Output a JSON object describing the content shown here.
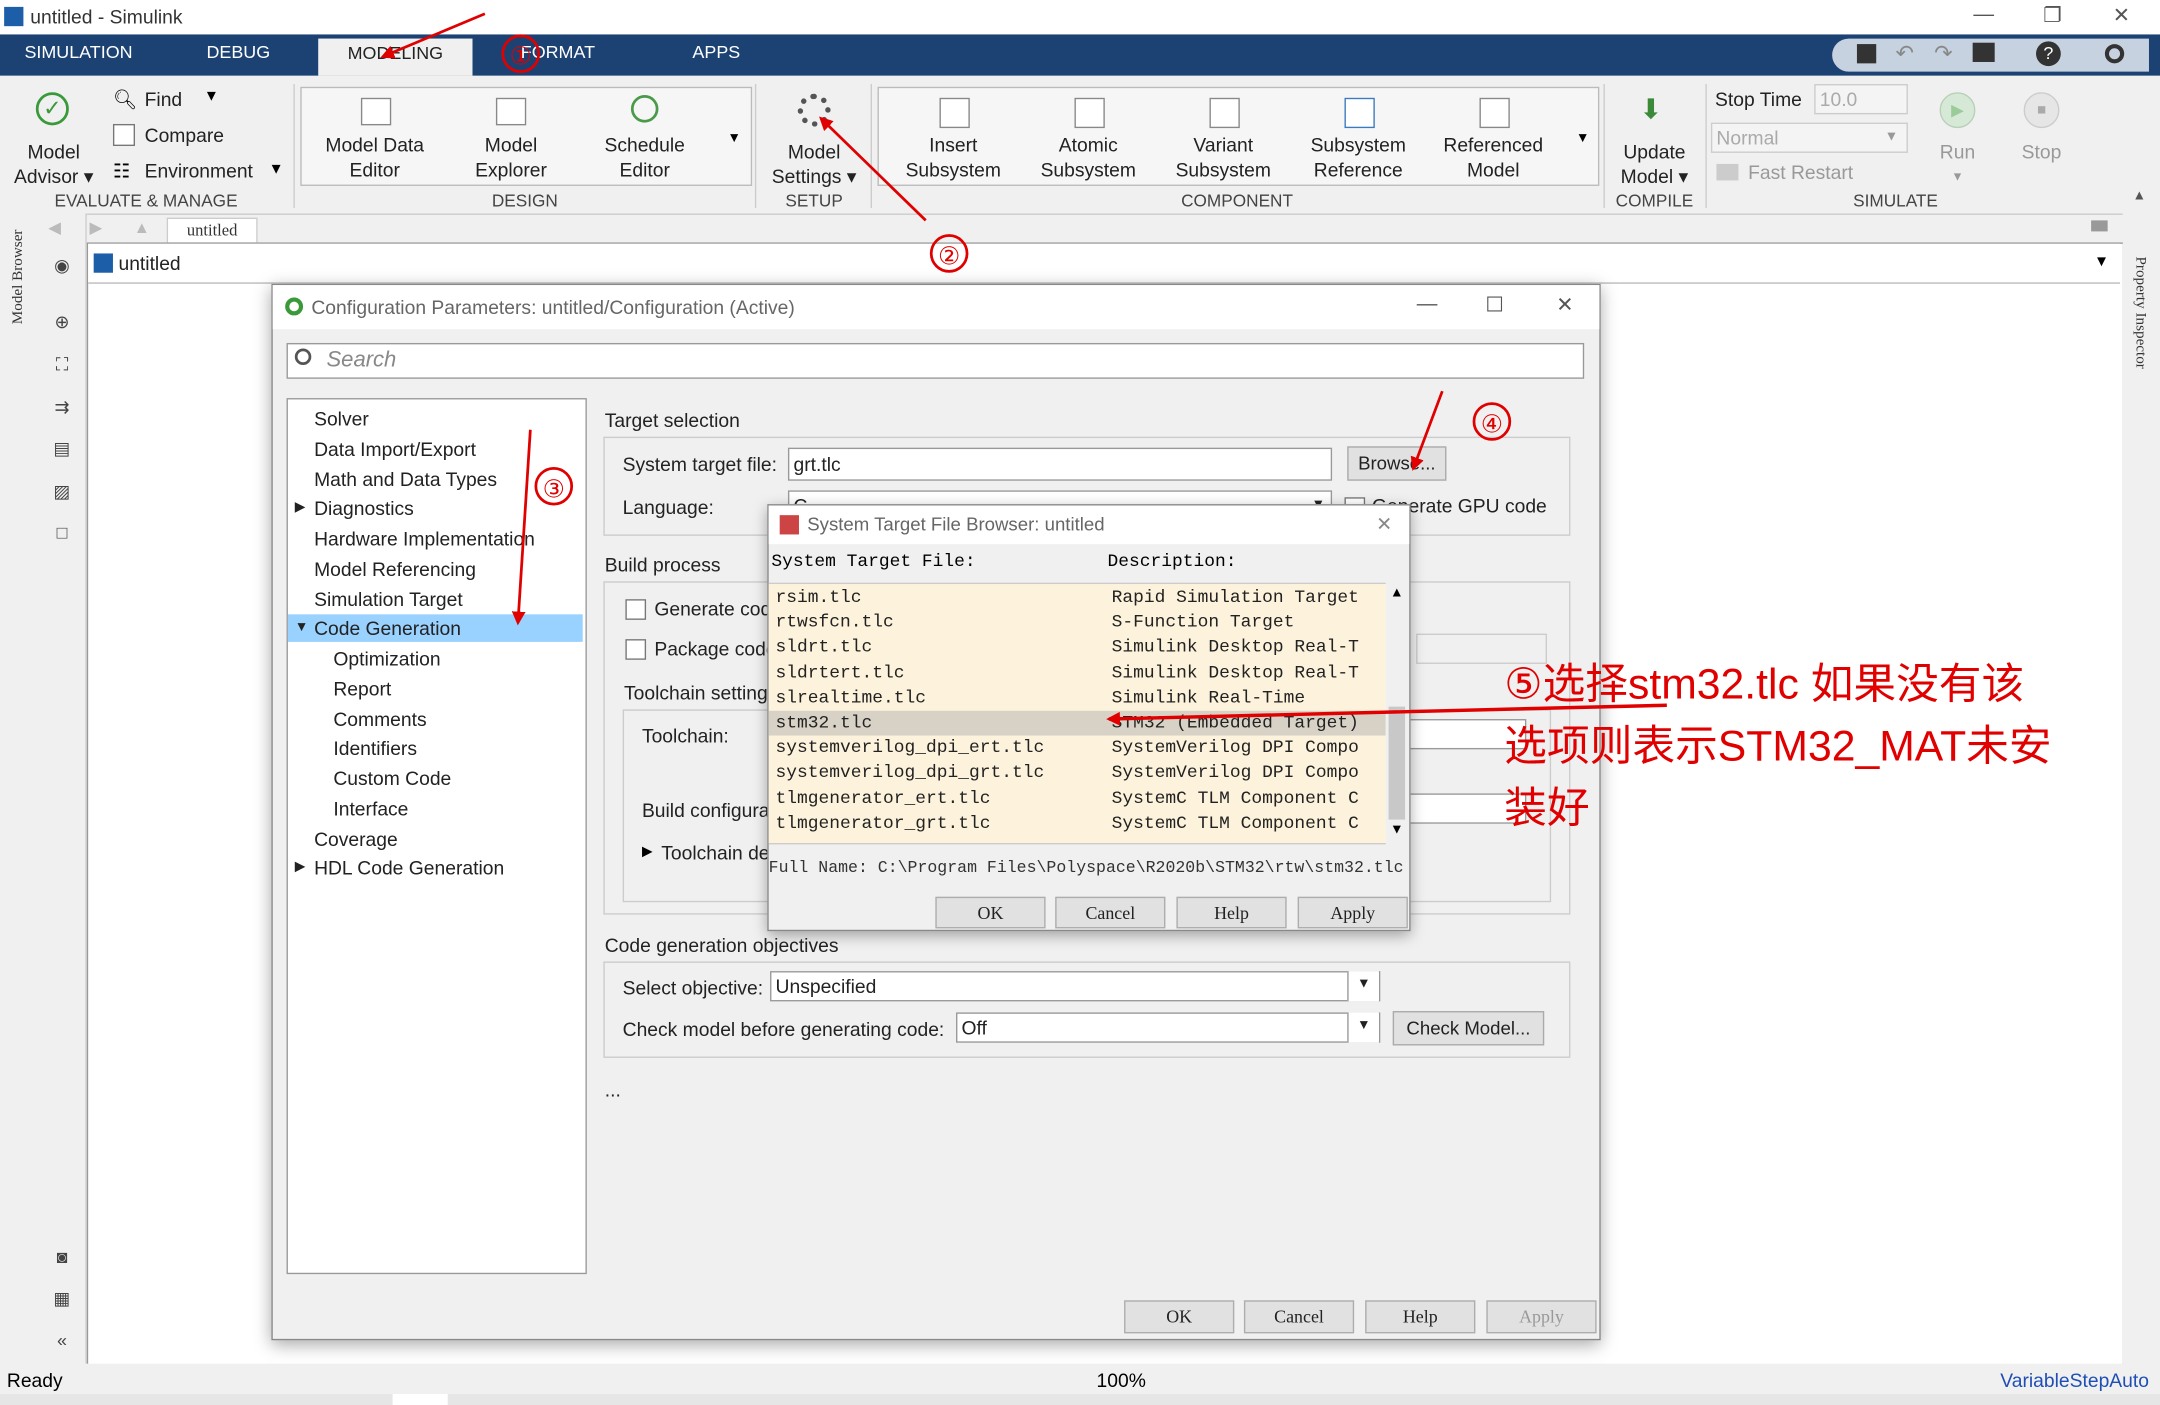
{
  "window": {
    "title": "untitled - Simulink"
  },
  "tabs": [
    "SIMULATION",
    "DEBUG",
    "MODELING",
    "FORMAT",
    "APPS"
  ],
  "ribbon": {
    "evaluate": {
      "model_advisor": [
        "Model",
        "Advisor"
      ],
      "find": "Find",
      "compare": "Compare",
      "environment": "Environment",
      "group": "EVALUATE & MANAGE"
    },
    "design": {
      "items": [
        [
          "Model Data",
          "Editor"
        ],
        [
          "Model",
          "Explorer"
        ],
        [
          "Schedule",
          "Editor"
        ]
      ],
      "group": "DESIGN"
    },
    "setup": {
      "item": [
        "Model",
        "Settings"
      ],
      "group": "SETUP"
    },
    "component": {
      "items": [
        [
          "Insert",
          "Subsystem"
        ],
        [
          "Atomic",
          "Subsystem"
        ],
        [
          "Variant",
          "Subsystem"
        ],
        [
          "Subsystem",
          "Reference"
        ],
        [
          "Referenced",
          "Model"
        ]
      ],
      "group": "COMPONENT"
    },
    "compile": {
      "item": [
        "Update",
        "Model"
      ],
      "group": "COMPILE"
    },
    "simulate": {
      "stop_time_label": "Stop Time",
      "stop_time": "10.0",
      "mode": "Normal",
      "fast_restart": "Fast Restart",
      "run": "Run",
      "stop": "Stop",
      "group": "SIMULATE"
    }
  },
  "side_tabs": {
    "left": "Model Browser",
    "right": "Property Inspector"
  },
  "editor": {
    "breadcrumb_tab": "untitled",
    "path": "untitled"
  },
  "status": {
    "left": "Ready",
    "zoom": "100%",
    "solver": "VariableStepAuto"
  },
  "config": {
    "title": "Configuration Parameters: untitled/Configuration (Active)",
    "search_placeholder": "Search",
    "tree": [
      {
        "label": "Solver",
        "level": 0
      },
      {
        "label": "Data Import/Export",
        "level": 0
      },
      {
        "label": "Math and Data Types",
        "level": 0
      },
      {
        "label": "Diagnostics",
        "level": 0,
        "arrow": "▶"
      },
      {
        "label": "Hardware Implementation",
        "level": 0
      },
      {
        "label": "Model Referencing",
        "level": 0
      },
      {
        "label": "Simulation Target",
        "level": 0
      },
      {
        "label": "Code Generation",
        "level": 0,
        "arrow": "▼",
        "selected": true
      },
      {
        "label": "Optimization",
        "level": 1
      },
      {
        "label": "Report",
        "level": 1
      },
      {
        "label": "Comments",
        "level": 1
      },
      {
        "label": "Identifiers",
        "level": 1
      },
      {
        "label": "Custom Code",
        "level": 1
      },
      {
        "label": "Interface",
        "level": 1
      },
      {
        "label": "Coverage",
        "level": 0
      },
      {
        "label": "HDL Code Generation",
        "level": 0,
        "arrow": "▶"
      }
    ],
    "target_selection": "Target selection",
    "system_target_label": "System target file:",
    "system_target_value": "grt.tlc",
    "browse": "Browse...",
    "language_label": "Language:",
    "language_value": "C",
    "gpu": "Generate GPU code",
    "build_process": "Build process",
    "generate_code": "Generate code only",
    "package_code": "Package code and artifacts",
    "toolchain_settings": "Toolchain settings",
    "toolchain_label": "Toolchain:",
    "build_config_label": "Build configuration",
    "toolchain_details": "Toolchain details",
    "objectives": "Code generation objectives",
    "select_objective_label": "Select objective:",
    "select_objective_value": "Unspecified",
    "check_model_label": "Check model before generating code:",
    "check_model_value": "Off",
    "check_model_btn": "Check Model...",
    "ellipsis": "...",
    "buttons": [
      "OK",
      "Cancel",
      "Help",
      "Apply"
    ]
  },
  "browser": {
    "title": "System Target File Browser: untitled",
    "col1": "System Target File:",
    "col2": "Description:",
    "rows": [
      [
        "rsim.tlc",
        "Rapid Simulation Target"
      ],
      [
        "rtwsfcn.tlc",
        "S-Function Target"
      ],
      [
        "sldrt.tlc",
        "Simulink Desktop Real-T"
      ],
      [
        "sldrtert.tlc",
        "Simulink Desktop Real-T"
      ],
      [
        "slrealtime.tlc",
        "Simulink Real-Time"
      ],
      [
        "stm32.tlc",
        "STM32 (Embedded Target)"
      ],
      [
        "systemverilog_dpi_ert.tlc",
        "SystemVerilog DPI Compo"
      ],
      [
        "systemverilog_dpi_grt.tlc",
        "SystemVerilog DPI Compo"
      ],
      [
        "tlmgenerator_ert.tlc",
        "SystemC TLM Component C"
      ],
      [
        "tlmgenerator_grt.tlc",
        "SystemC TLM Component C"
      ]
    ],
    "selected_index": 5,
    "full_name": "Full Name: C:\\Program Files\\Polyspace\\R2020b\\STM32\\rtw\\stm32.tlc",
    "buttons": [
      "OK",
      "Cancel",
      "Help",
      "Apply"
    ]
  },
  "annotations": {
    "n1": "①",
    "n2": "②",
    "n3": "③",
    "n4": "④",
    "note": [
      "⑤选择stm32.tlc 如果没有该",
      "选项则表示STM32_MAT未安",
      "装好"
    ],
    "color": "#e00000"
  },
  "colors": {
    "tabbar": "#1c4273",
    "selection": "#99d1ff",
    "browser_list_bg": "#fdf3dc",
    "browser_selected": "#d8d2c6"
  }
}
